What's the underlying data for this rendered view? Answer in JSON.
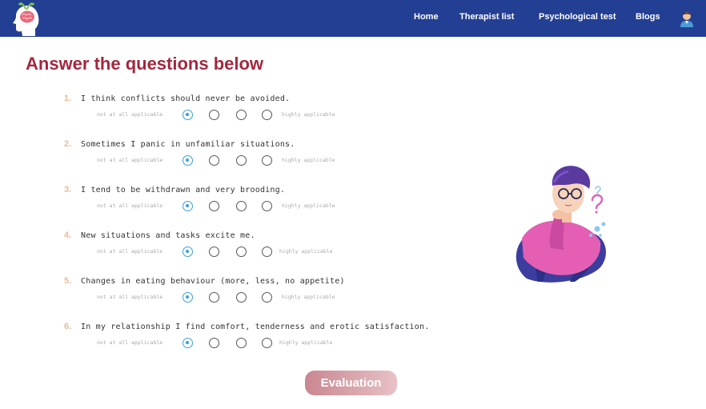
{
  "nav": {
    "home": "Home",
    "therapist_list": "Therapist list",
    "psych_test": "Psychological test",
    "blogs": "Blogs"
  },
  "page": {
    "title": "Answer the questions below"
  },
  "scale": {
    "low": "not at all applicable",
    "high": "highly applicable"
  },
  "questions": [
    {
      "num": "1.",
      "text": "I think conflicts should never be avoided.",
      "selected": 1
    },
    {
      "num": "2.",
      "text": "Sometimes I panic in unfamiliar situations.",
      "selected": 1
    },
    {
      "num": "3.",
      "text": "I tend to be withdrawn and very brooding.",
      "selected": 1
    },
    {
      "num": "4.",
      "text": "New situations and tasks excite me.",
      "selected": 1
    },
    {
      "num": "5.",
      "text": "Changes in eating behaviour (more, less, no appetite)",
      "selected": 1
    },
    {
      "num": "6.",
      "text": "In my relationship I find comfort, tenderness and erotic satisfaction.",
      "selected": 1
    }
  ],
  "actions": {
    "evaluate": "Evaluation"
  },
  "colors": {
    "navbar": "#233f93",
    "title": "#a3283f",
    "question_number": "#f0b99b",
    "radio_selected": "#3b9fd9",
    "button_gradient_start": "#c98790",
    "button_gradient_end": "#e8c1c6"
  },
  "icons": {
    "logo": "brain-head-logo-icon",
    "avatar": "user-avatar-icon",
    "illustration": "thinking-man-illustration"
  }
}
